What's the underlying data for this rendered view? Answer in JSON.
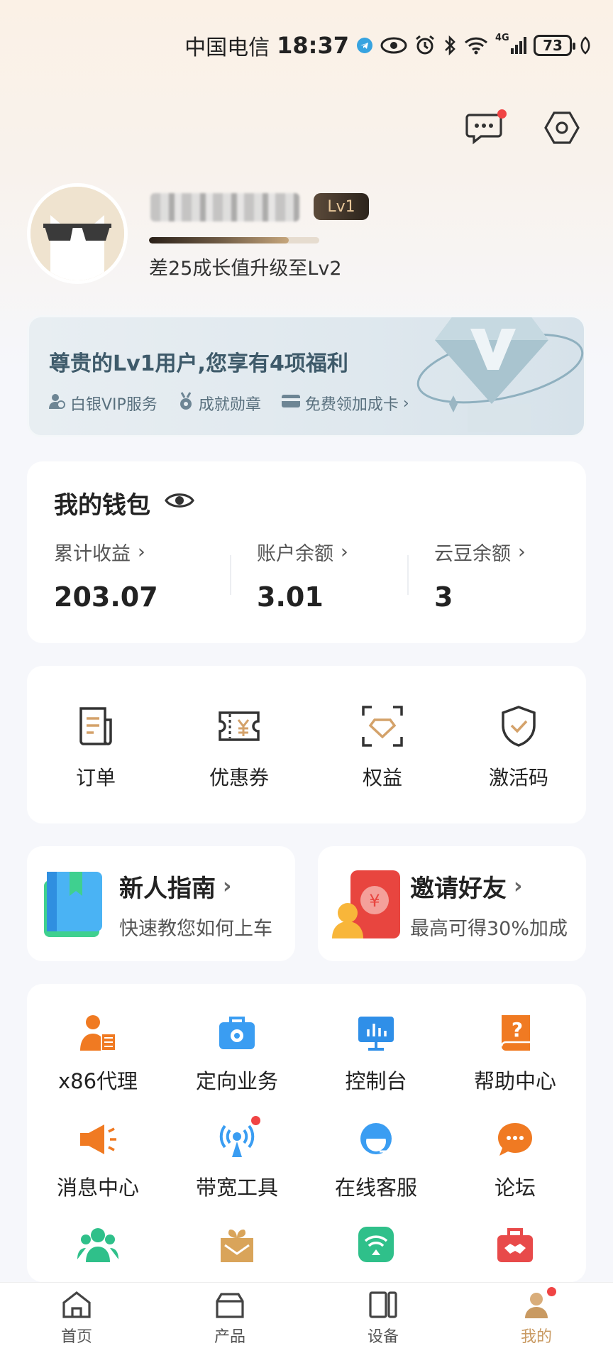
{
  "status_bar": {
    "carrier": "中国电信",
    "time": "18:37",
    "network": "4G",
    "battery": "73"
  },
  "profile": {
    "level_badge": "Lv1",
    "progress": 0.82,
    "upgrade_hint": "差25成长值升级至Lv2"
  },
  "vip_banner": {
    "title": "尊贵的Lv1用户,您享有4项福利",
    "benefits": [
      "白银VIP服务",
      "成就勋章",
      "免费领加成卡"
    ]
  },
  "wallet": {
    "title": "我的钱包",
    "items": [
      {
        "label": "累计收益",
        "value": "203.07"
      },
      {
        "label": "账户余额",
        "value": "3.01"
      },
      {
        "label": "云豆余额",
        "value": "3"
      }
    ]
  },
  "quick_actions": [
    {
      "label": "订单",
      "icon": "order-icon"
    },
    {
      "label": "优惠券",
      "icon": "coupon-icon"
    },
    {
      "label": "权益",
      "icon": "benefits-icon"
    },
    {
      "label": "激活码",
      "icon": "activation-code-icon"
    }
  ],
  "promos": [
    {
      "title": "新人指南",
      "subtitle": "快速教您如何上车",
      "icon": "guide-book-icon"
    },
    {
      "title": "邀请好友",
      "subtitle": "最高可得30%加成",
      "icon": "invite-red-packet-icon"
    }
  ],
  "services": [
    {
      "label": "x86代理",
      "icon": "x86-proxy-icon",
      "color": "#f07a22"
    },
    {
      "label": "定向业务",
      "icon": "targeted-business-icon",
      "color": "#3a9df2"
    },
    {
      "label": "控制台",
      "icon": "console-icon",
      "color": "#2f8fe8"
    },
    {
      "label": "帮助中心",
      "icon": "help-center-icon",
      "color": "#f07a22"
    },
    {
      "label": "消息中心",
      "icon": "message-center-icon",
      "color": "#f07a22"
    },
    {
      "label": "带宽工具",
      "icon": "bandwidth-tool-icon",
      "color": "#3a9df2"
    },
    {
      "label": "在线客服",
      "icon": "customer-service-icon",
      "color": "#3a9df2"
    },
    {
      "label": "论坛",
      "icon": "forum-icon",
      "color": "#f07a22"
    },
    {
      "label": "",
      "icon": "team-icon",
      "color": "#2fc08a"
    },
    {
      "label": "",
      "icon": "gift-mail-icon",
      "color": "#d9a45a"
    },
    {
      "label": "",
      "icon": "wifi-signal-icon",
      "color": "#2fc08a"
    },
    {
      "label": "",
      "icon": "cooperation-icon",
      "color": "#e84a4a"
    }
  ],
  "bottom_nav": [
    {
      "label": "首页",
      "icon": "home-icon"
    },
    {
      "label": "产品",
      "icon": "product-icon"
    },
    {
      "label": "设备",
      "icon": "device-icon"
    },
    {
      "label": "我的",
      "icon": "profile-icon",
      "active": true
    }
  ],
  "colors": {
    "accent_gold": "#c99a62",
    "badge_red": "#f04444",
    "orange": "#f07a22",
    "blue": "#3a9df2"
  }
}
